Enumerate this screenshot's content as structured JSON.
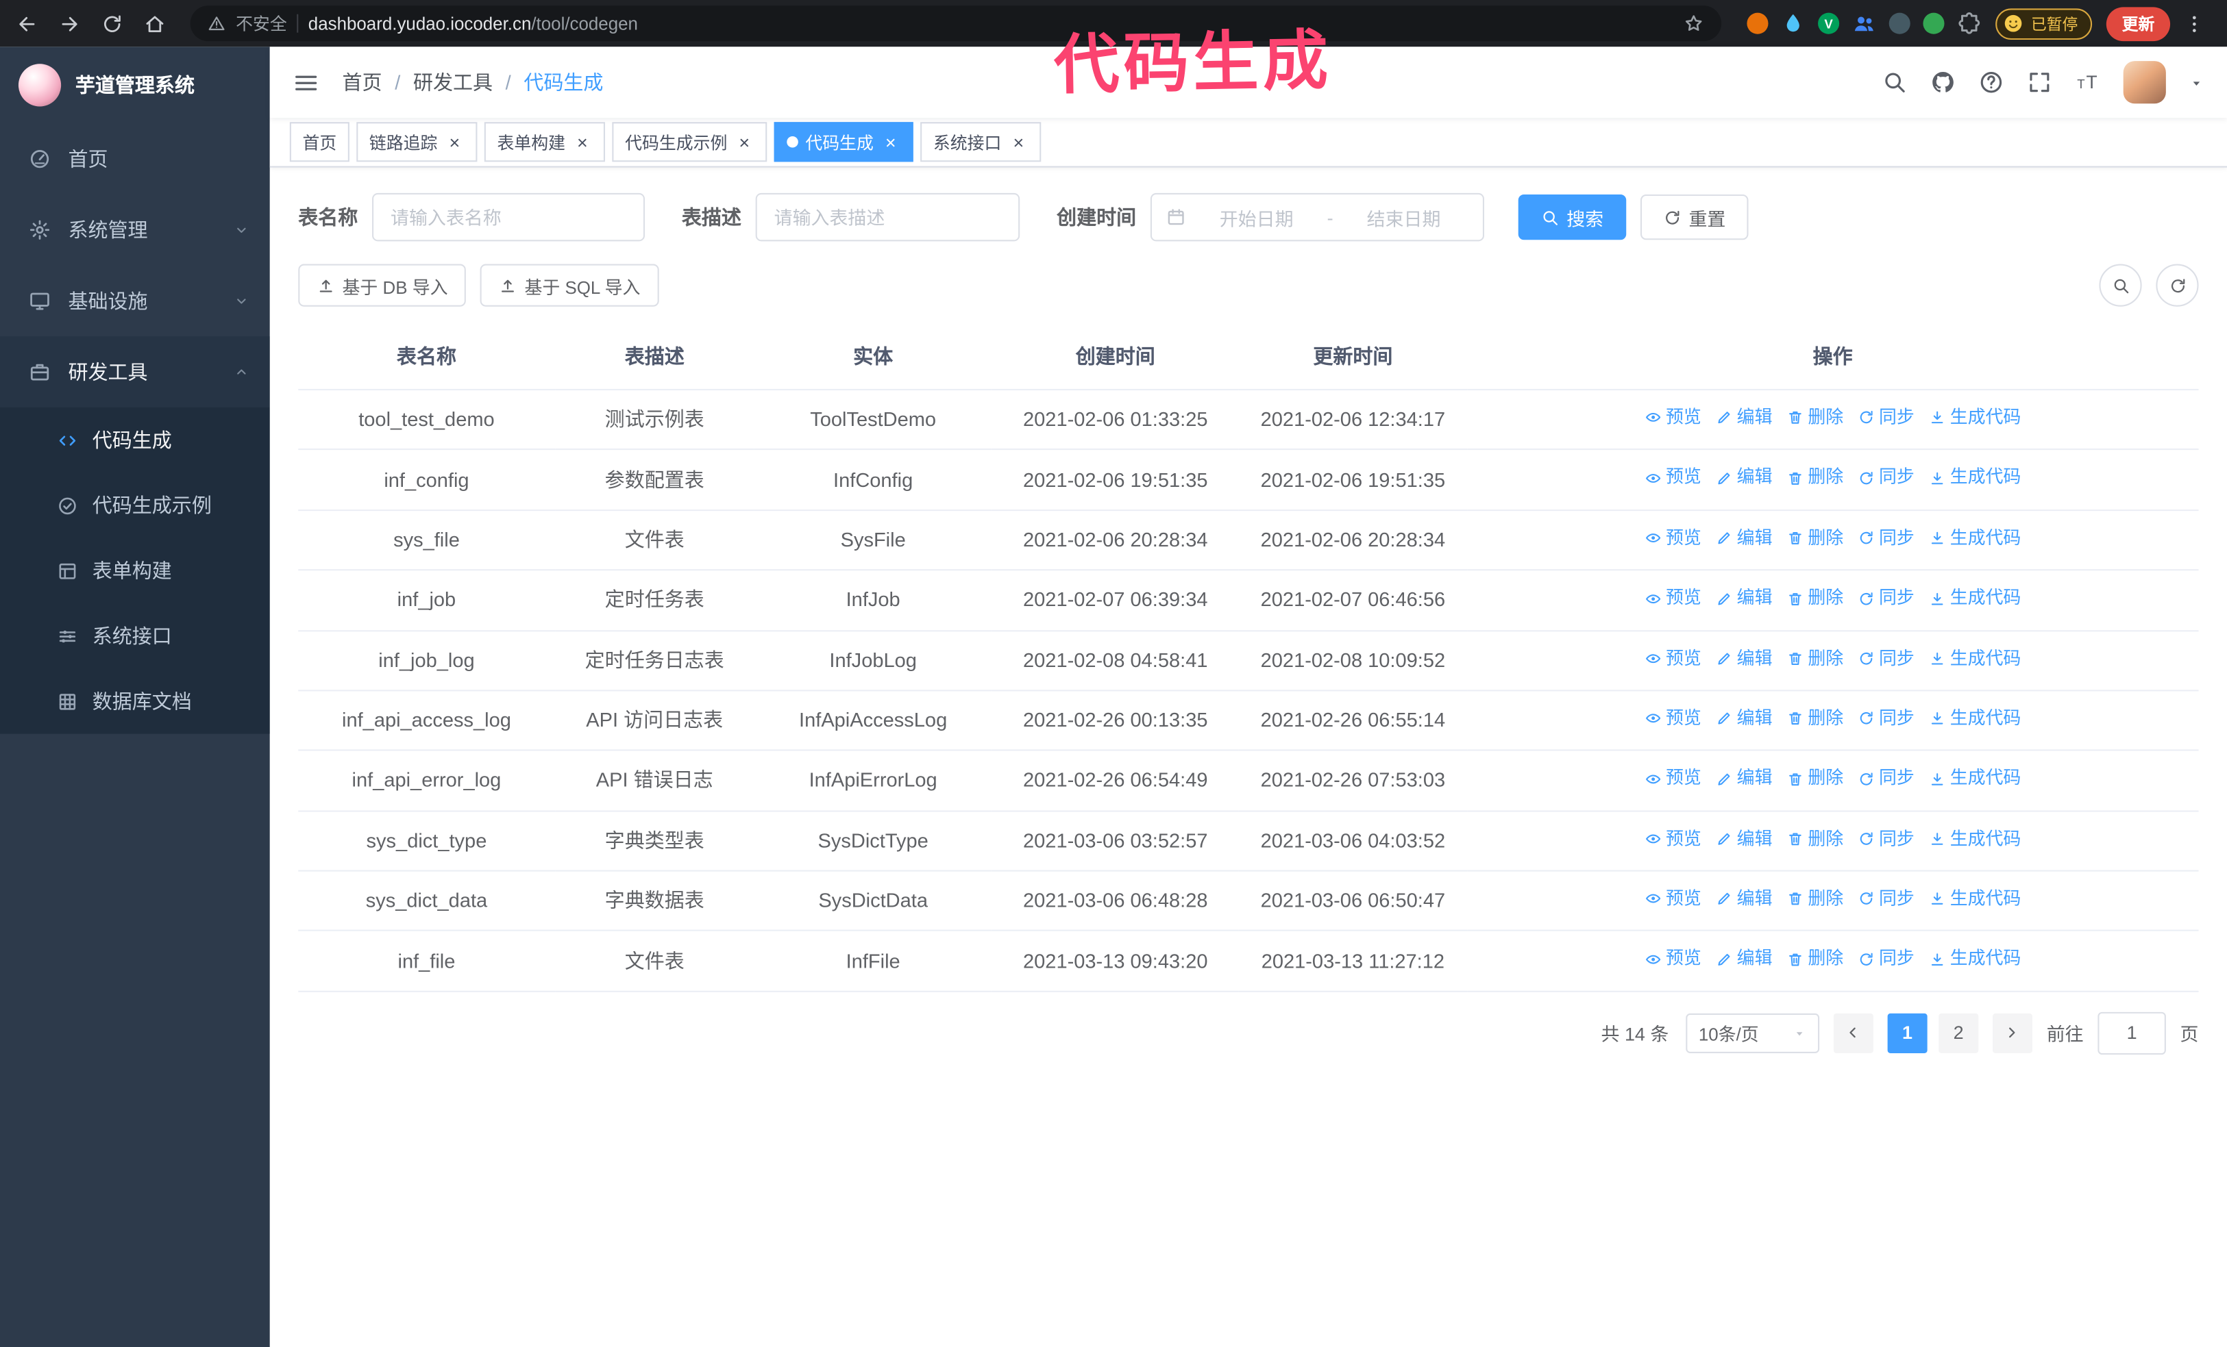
{
  "annotation": {
    "text": "代码生成",
    "color": "#fb4370"
  },
  "browser": {
    "security_label": "不安全",
    "url_host": "dashboard.yudao.iocoder.cn",
    "url_path": "/tool/codegen",
    "paused_badge": "已暂停",
    "update_button": "更新",
    "extensions": [
      {
        "name": "extension-orange",
        "color": "#e8710a",
        "shape": "circle",
        "letter": ""
      },
      {
        "name": "extension-drop",
        "color": "#4fc3f7",
        "shape": "drop"
      },
      {
        "name": "extension-green-v",
        "color": "#00a05a",
        "shape": "circle",
        "letter": "V"
      },
      {
        "name": "extension-people",
        "color": "#4285f4",
        "shape": "people"
      },
      {
        "name": "extension-dark",
        "color": "#455a64",
        "shape": "circle",
        "letter": ""
      },
      {
        "name": "extension-leaf",
        "color": "#34a853",
        "shape": "circle",
        "letter": ""
      },
      {
        "name": "extensions-puzzle",
        "color": "#9aa0a6",
        "shape": "puzzle"
      }
    ]
  },
  "sidebar": {
    "logo_title": "芋道管理系统",
    "items": [
      {
        "id": "home",
        "label": "首页",
        "icon": "dashboard"
      },
      {
        "id": "system",
        "label": "系统管理",
        "icon": "gear",
        "chevron": "down"
      },
      {
        "id": "infra",
        "label": "基础设施",
        "icon": "infra",
        "chevron": "down"
      },
      {
        "id": "devtools",
        "label": "研发工具",
        "icon": "toolbox",
        "chevron": "up",
        "open": true,
        "children": [
          {
            "id": "codegen",
            "label": "代码生成",
            "icon": "code",
            "active": true
          },
          {
            "id": "codegen-example",
            "label": "代码生成示例",
            "icon": "badge"
          },
          {
            "id": "form-builder",
            "label": "表单构建",
            "icon": "form"
          },
          {
            "id": "system-api",
            "label": "系统接口",
            "icon": "sliders"
          },
          {
            "id": "db-doc",
            "label": "数据库文档",
            "icon": "grid"
          }
        ]
      }
    ]
  },
  "navbar": {
    "breadcrumb": [
      "首页",
      "研发工具",
      "代码生成"
    ]
  },
  "tags": [
    {
      "id": "home",
      "label": "首页"
    },
    {
      "id": "tracer",
      "label": "链路追踪",
      "closable": true
    },
    {
      "id": "form-builder",
      "label": "表单构建",
      "closable": true
    },
    {
      "id": "codegen-example",
      "label": "代码生成示例",
      "closable": true
    },
    {
      "id": "codegen",
      "label": "代码生成",
      "closable": true,
      "active": true
    },
    {
      "id": "system-api",
      "label": "系统接口",
      "closable": true
    }
  ],
  "filters": {
    "table_name_label": "表名称",
    "table_name_placeholder": "请输入表名称",
    "table_desc_label": "表描述",
    "table_desc_placeholder": "请输入表描述",
    "create_time_label": "创建时间",
    "start_placeholder": "开始日期",
    "range_separator": "-",
    "end_placeholder": "结束日期",
    "search_button": "搜索",
    "reset_button": "重置"
  },
  "toolbar": {
    "import_db": "基于 DB 导入",
    "import_sql": "基于 SQL 导入"
  },
  "table": {
    "columns": [
      "表名称",
      "表描述",
      "实体",
      "创建时间",
      "更新时间",
      "操作"
    ],
    "actions": [
      "预览",
      "编辑",
      "删除",
      "同步",
      "生成代码"
    ],
    "rows": [
      {
        "name": "tool_test_demo",
        "desc": "测试示例表",
        "entity": "ToolTestDemo",
        "created": "2021-02-06 01:33:25",
        "updated": "2021-02-06 12:34:17"
      },
      {
        "name": "inf_config",
        "desc": "参数配置表",
        "entity": "InfConfig",
        "created": "2021-02-06 19:51:35",
        "updated": "2021-02-06 19:51:35"
      },
      {
        "name": "sys_file",
        "desc": "文件表",
        "entity": "SysFile",
        "created": "2021-02-06 20:28:34",
        "updated": "2021-02-06 20:28:34"
      },
      {
        "name": "inf_job",
        "desc": "定时任务表",
        "entity": "InfJob",
        "created": "2021-02-07 06:39:34",
        "updated": "2021-02-07 06:46:56"
      },
      {
        "name": "inf_job_log",
        "desc": "定时任务日志表",
        "entity": "InfJobLog",
        "created": "2021-02-08 04:58:41",
        "updated": "2021-02-08 10:09:52"
      },
      {
        "name": "inf_api_access_log",
        "desc": "API 访问日志表",
        "entity": "InfApiAccessLog",
        "created": "2021-02-26 00:13:35",
        "updated": "2021-02-26 06:55:14"
      },
      {
        "name": "inf_api_error_log",
        "desc": "API 错误日志",
        "entity": "InfApiErrorLog",
        "created": "2021-02-26 06:54:49",
        "updated": "2021-02-26 07:53:03"
      },
      {
        "name": "sys_dict_type",
        "desc": "字典类型表",
        "entity": "SysDictType",
        "created": "2021-03-06 03:52:57",
        "updated": "2021-03-06 04:03:52"
      },
      {
        "name": "sys_dict_data",
        "desc": "字典数据表",
        "entity": "SysDictData",
        "created": "2021-03-06 06:48:28",
        "updated": "2021-03-06 06:50:47"
      },
      {
        "name": "inf_file",
        "desc": "文件表",
        "entity": "InfFile",
        "created": "2021-03-13 09:43:20",
        "updated": "2021-03-13 11:27:12"
      }
    ]
  },
  "pagination": {
    "total_text": "共 14 条",
    "page_size": "10条/页",
    "pages": [
      "1",
      "2"
    ],
    "active_page": "1",
    "goto_label": "前往",
    "goto_value": "1",
    "goto_suffix": "页"
  },
  "colors": {
    "accent": "#409eff",
    "sidebar_bg": "#2d3a4b",
    "submenu_bg": "#1f2d3d",
    "tag_active": "#409eff",
    "annotation": "#fb4370",
    "update_button": "#e0483e",
    "browser_bar": "#1f2125"
  }
}
